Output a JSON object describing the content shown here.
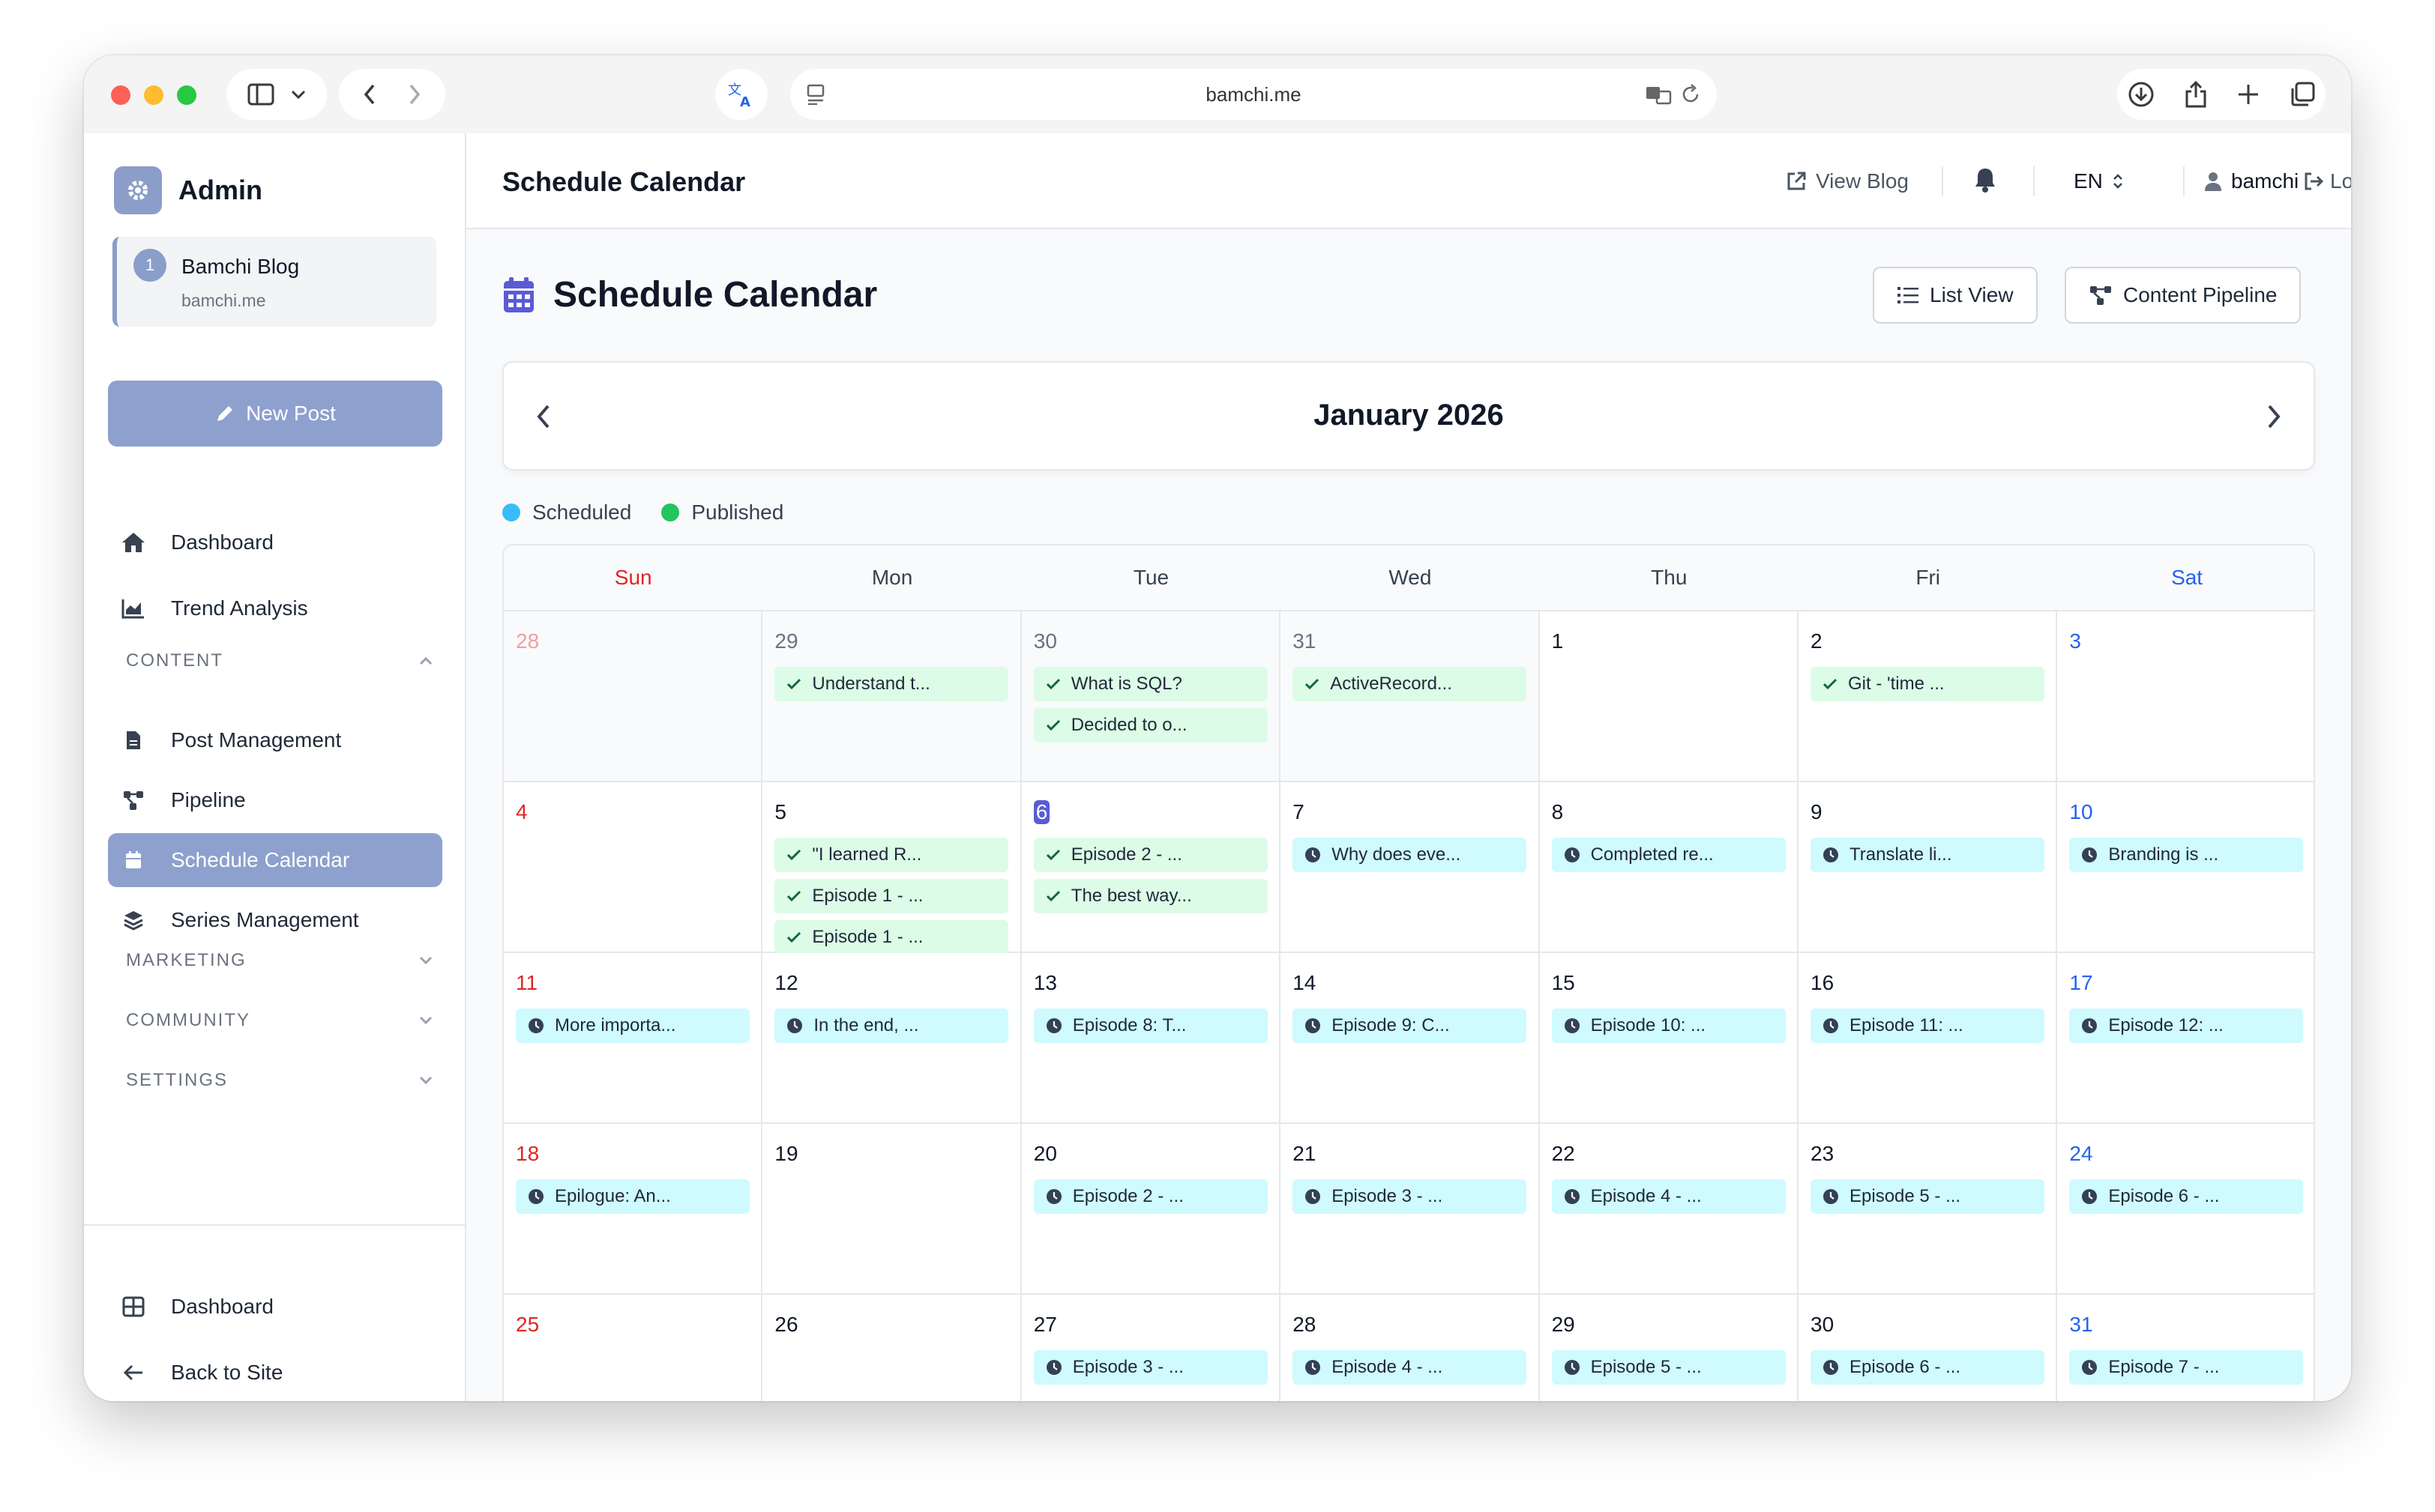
{
  "browser": {
    "url": "bamchi.me"
  },
  "sidebar": {
    "brand": "Admin",
    "site": {
      "number": "1",
      "name": "Bamchi Blog",
      "domain": "bamchi.me"
    },
    "new_post": "New Post",
    "items": {
      "dashboard": "Dashboard",
      "trend": "Trend Analysis",
      "post_mgmt": "Post Management",
      "pipeline": "Pipeline",
      "schedule": "Schedule Calendar",
      "series": "Series Management"
    },
    "sections": {
      "content": "CONTENT",
      "marketing": "MARKETING",
      "community": "COMMUNITY",
      "settings": "SETTINGS"
    },
    "footer": {
      "dashboard": "Dashboard",
      "back": "Back to Site"
    }
  },
  "topbar": {
    "title": "Schedule Calendar",
    "view_blog": "View Blog",
    "lang": "EN",
    "user": "bamchi",
    "logout": "Logout"
  },
  "main": {
    "title": "Schedule Calendar",
    "list_view": "List View",
    "pipeline": "Content Pipeline",
    "month": "January 2026",
    "legend": {
      "scheduled": "Scheduled",
      "published": "Published"
    },
    "colors": {
      "scheduled": "#38bdf8",
      "published": "#22c55e",
      "accent": "#8ea0cd"
    },
    "weekdays": [
      "Sun",
      "Mon",
      "Tue",
      "Wed",
      "Thu",
      "Fri",
      "Sat"
    ],
    "weeks": [
      [
        {
          "day": "28",
          "other": true,
          "events": []
        },
        {
          "day": "29",
          "other": true,
          "events": [
            {
              "type": "published",
              "title": "Understand t..."
            }
          ]
        },
        {
          "day": "30",
          "other": true,
          "events": [
            {
              "type": "published",
              "title": "What is SQL?"
            },
            {
              "type": "published",
              "title": "Decided to o..."
            }
          ]
        },
        {
          "day": "31",
          "other": true,
          "events": [
            {
              "type": "published",
              "title": "ActiveRecord..."
            }
          ]
        },
        {
          "day": "1",
          "events": []
        },
        {
          "day": "2",
          "events": [
            {
              "type": "published",
              "title": "Git - 'time ..."
            }
          ]
        },
        {
          "day": "3",
          "events": []
        }
      ],
      [
        {
          "day": "4",
          "events": []
        },
        {
          "day": "5",
          "events": [
            {
              "type": "published",
              "title": "\"I learned R..."
            },
            {
              "type": "published",
              "title": "Episode 1 - ..."
            },
            {
              "type": "published",
              "title": "Episode 1 - ..."
            }
          ]
        },
        {
          "day": "6",
          "today": true,
          "events": [
            {
              "type": "published",
              "title": "Episode 2 - ..."
            },
            {
              "type": "published",
              "title": "The best way..."
            }
          ]
        },
        {
          "day": "7",
          "events": [
            {
              "type": "scheduled",
              "title": "Why does eve..."
            }
          ]
        },
        {
          "day": "8",
          "events": [
            {
              "type": "scheduled",
              "title": "Completed re..."
            }
          ]
        },
        {
          "day": "9",
          "events": [
            {
              "type": "scheduled",
              "title": "Translate li..."
            }
          ]
        },
        {
          "day": "10",
          "events": [
            {
              "type": "scheduled",
              "title": "Branding is ..."
            }
          ]
        }
      ],
      [
        {
          "day": "11",
          "events": [
            {
              "type": "scheduled",
              "title": "More importa..."
            }
          ]
        },
        {
          "day": "12",
          "events": [
            {
              "type": "scheduled",
              "title": "In the end, ..."
            }
          ]
        },
        {
          "day": "13",
          "events": [
            {
              "type": "scheduled",
              "title": "Episode 8: T..."
            }
          ]
        },
        {
          "day": "14",
          "events": [
            {
              "type": "scheduled",
              "title": "Episode 9: C..."
            }
          ]
        },
        {
          "day": "15",
          "events": [
            {
              "type": "scheduled",
              "title": "Episode 10: ..."
            }
          ]
        },
        {
          "day": "16",
          "events": [
            {
              "type": "scheduled",
              "title": "Episode 11: ..."
            }
          ]
        },
        {
          "day": "17",
          "events": [
            {
              "type": "scheduled",
              "title": "Episode 12: ..."
            }
          ]
        }
      ],
      [
        {
          "day": "18",
          "events": [
            {
              "type": "scheduled",
              "title": "Epilogue: An..."
            }
          ]
        },
        {
          "day": "19",
          "events": []
        },
        {
          "day": "20",
          "events": [
            {
              "type": "scheduled",
              "title": "Episode 2 - ..."
            }
          ]
        },
        {
          "day": "21",
          "events": [
            {
              "type": "scheduled",
              "title": "Episode 3 - ..."
            }
          ]
        },
        {
          "day": "22",
          "events": [
            {
              "type": "scheduled",
              "title": "Episode 4 - ..."
            }
          ]
        },
        {
          "day": "23",
          "events": [
            {
              "type": "scheduled",
              "title": "Episode 5 - ..."
            }
          ]
        },
        {
          "day": "24",
          "events": [
            {
              "type": "scheduled",
              "title": "Episode 6 - ..."
            }
          ]
        }
      ],
      [
        {
          "day": "25",
          "events": []
        },
        {
          "day": "26",
          "events": []
        },
        {
          "day": "27",
          "events": [
            {
              "type": "scheduled",
              "title": "Episode 3 - ..."
            }
          ]
        },
        {
          "day": "28",
          "events": [
            {
              "type": "scheduled",
              "title": "Episode 4 - ..."
            }
          ]
        },
        {
          "day": "29",
          "events": [
            {
              "type": "scheduled",
              "title": "Episode 5 - ..."
            }
          ]
        },
        {
          "day": "30",
          "events": [
            {
              "type": "scheduled",
              "title": "Episode 6 - ..."
            }
          ]
        },
        {
          "day": "31",
          "events": [
            {
              "type": "scheduled",
              "title": "Episode 7 - ..."
            }
          ]
        }
      ]
    ]
  }
}
